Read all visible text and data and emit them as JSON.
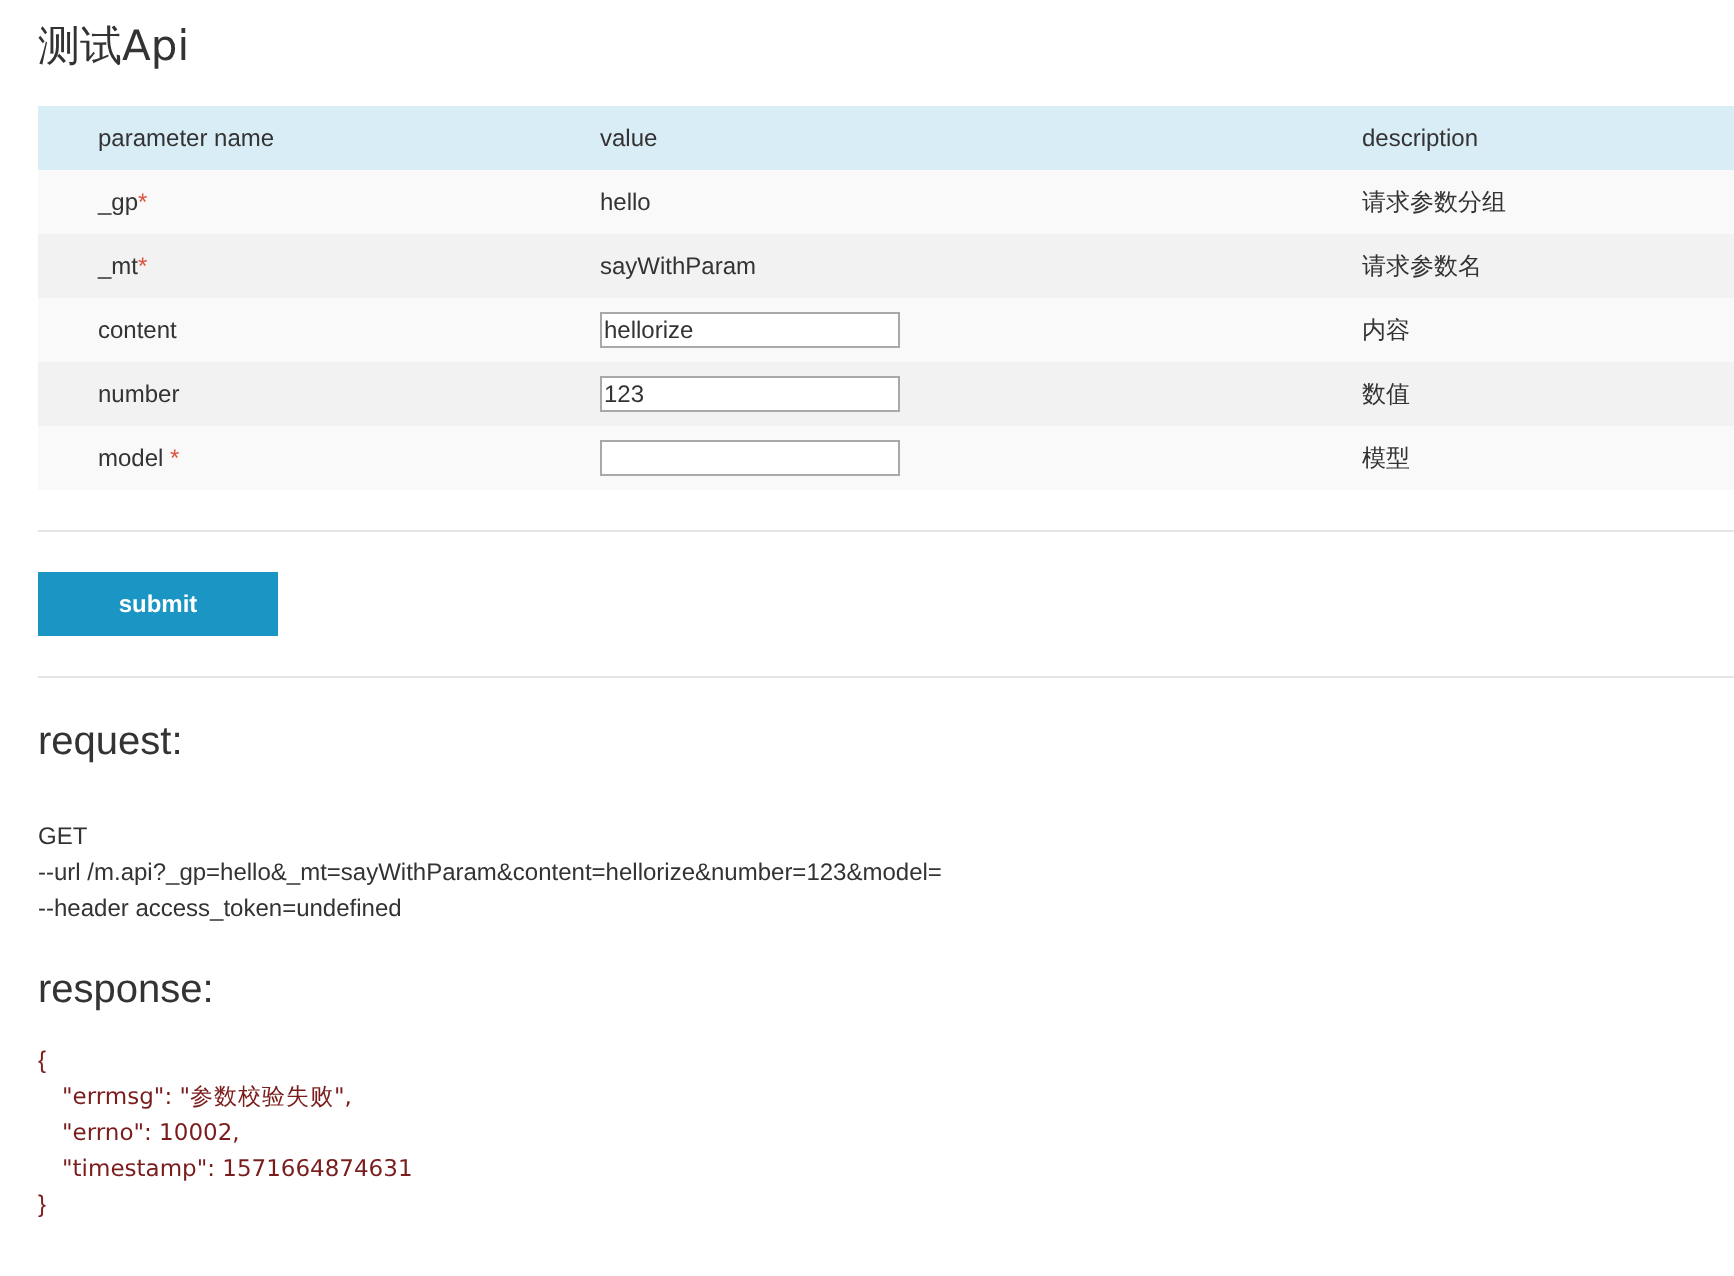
{
  "title": "测试Api",
  "table": {
    "columns": [
      "parameter name",
      "value",
      "description"
    ],
    "rows": [
      {
        "name": "_gp",
        "required": true,
        "kind": "text",
        "value": "hello",
        "description": "请求参数分组"
      },
      {
        "name": "_mt",
        "required": true,
        "kind": "text",
        "value": "sayWithParam",
        "description": "请求参数名"
      },
      {
        "name": "content",
        "required": false,
        "kind": "input",
        "value": "hellorize",
        "description": "内容"
      },
      {
        "name": "number",
        "required": false,
        "kind": "input",
        "value": "123",
        "description": "数值"
      },
      {
        "name": "model ",
        "required": true,
        "kind": "input",
        "description": "模型"
      }
    ]
  },
  "required_mark": "*",
  "submit": "submit",
  "request": {
    "heading": "request:",
    "lines": [
      "GET",
      "--url /m.api?_gp=hello&_mt=sayWithParam&content=hellorize&number=123&model=",
      "--header access_token=undefined"
    ]
  },
  "response": {
    "heading": "response:",
    "open": "{",
    "fields": [
      "\"errmsg\": \"参数校验失败\",",
      "\"errno\": 10002,",
      "\"timestamp\": 1571664874631"
    ],
    "close": "}"
  }
}
